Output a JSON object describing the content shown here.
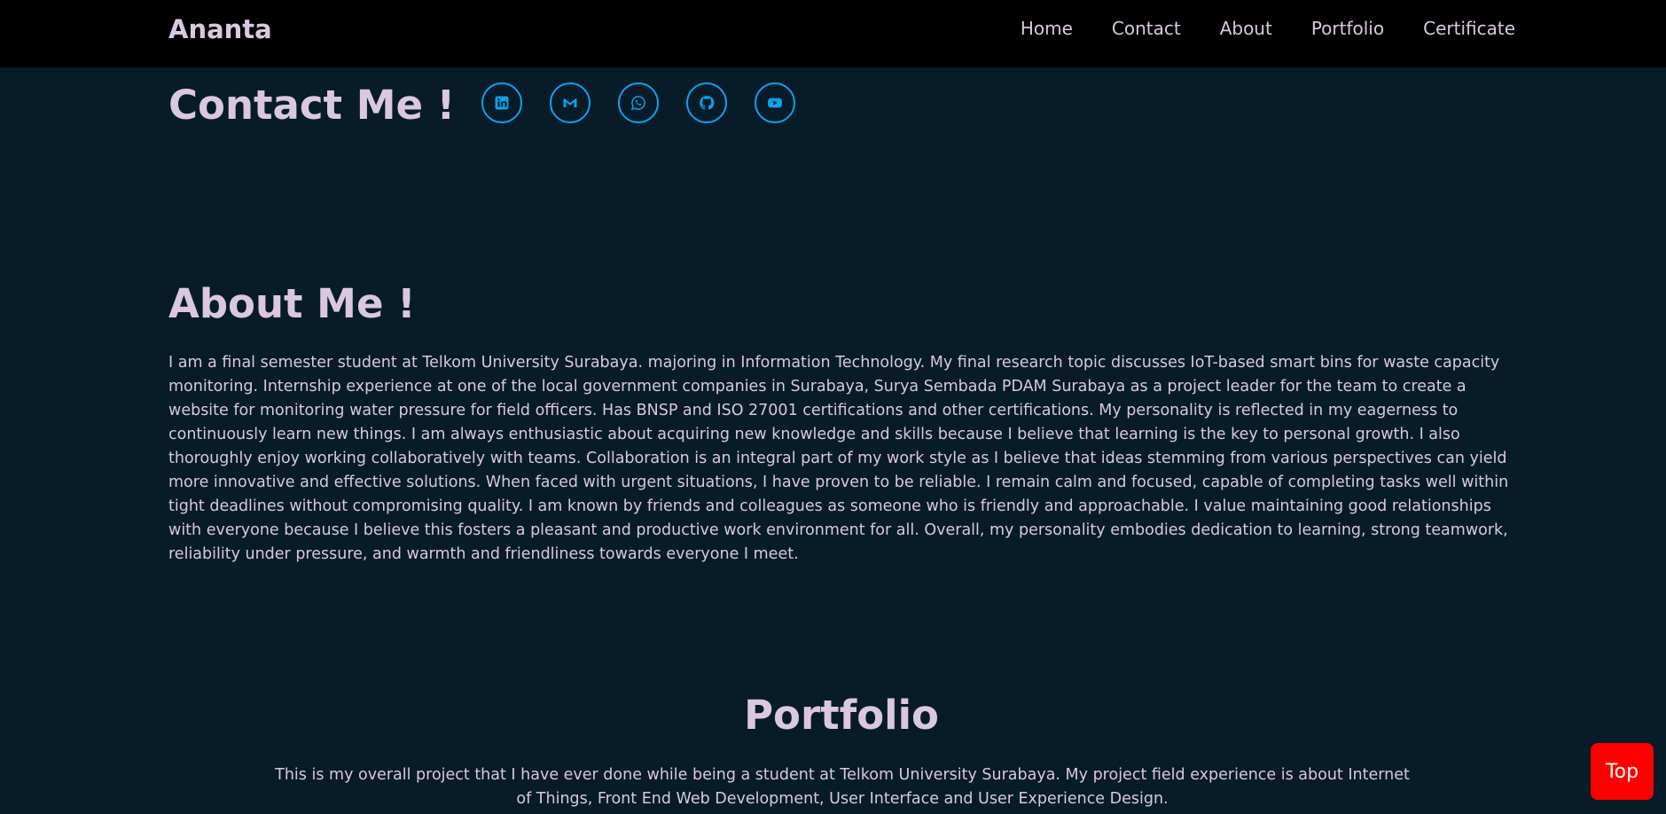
{
  "header": {
    "brand": "Ananta",
    "nav": [
      {
        "label": "Home"
      },
      {
        "label": "Contact"
      },
      {
        "label": "About"
      },
      {
        "label": "Portfolio"
      },
      {
        "label": "Certificate"
      }
    ]
  },
  "contact": {
    "title": "Contact Me !",
    "socials": [
      {
        "icon": "linkedin-icon"
      },
      {
        "icon": "gmail-icon"
      },
      {
        "icon": "whatsapp-icon"
      },
      {
        "icon": "github-icon"
      },
      {
        "icon": "youtube-icon"
      }
    ]
  },
  "about": {
    "title": "About Me !",
    "text": "I am a final semester student at Telkom University Surabaya. majoring in Information Technology. My final research topic discusses IoT-based smart bins for waste capacity monitoring. Internship experience at one of the local government companies in Surabaya, Surya Sembada PDAM Surabaya as a project leader for the team to create a website for monitoring water pressure for field officers. Has BNSP and ISO 27001 certifications and other certifications. My personality is reflected in my eagerness to continuously learn new things. I am always enthusiastic about acquiring new knowledge and skills because I believe that learning is the key to personal growth. I also thoroughly enjoy working collaboratively with teams. Collaboration is an integral part of my work style as I believe that ideas stemming from various perspectives can yield more innovative and effective solutions. When faced with urgent situations, I have proven to be reliable. I remain calm and focused, capable of completing tasks well within tight deadlines without compromising quality. I am known by friends and colleagues as someone who is friendly and approachable. I value maintaining good relationships with everyone because I believe this fosters a pleasant and productive work environment for all. Overall, my personality embodies dedication to learning, strong teamwork, reliability under pressure, and warmth and friendliness towards everyone I meet."
  },
  "portfolio": {
    "title": "Portfolio",
    "text": "This is my overall project that I have ever done while being a student at Telkom University Surabaya. My project field experience is about Internet of Things, Front End Web Development, User Interface and User Experience Design."
  },
  "top_button": {
    "label": "Top"
  },
  "colors": {
    "background": "#081b29",
    "navbar": "#000000",
    "text": "#d9c8df",
    "accent": "#0ea1e8",
    "top_button": "#ff0000"
  }
}
